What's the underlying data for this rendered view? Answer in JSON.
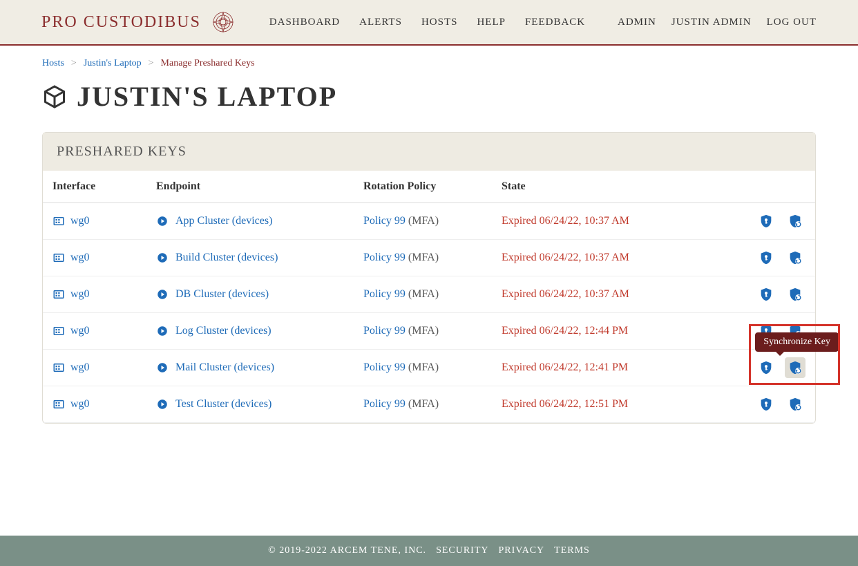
{
  "brand": "PRO CUSTODIBUS",
  "nav": {
    "dashboard": "DASHBOARD",
    "alerts": "ALERTS",
    "hosts": "HOSTS",
    "help": "HELP",
    "feedback": "FEEDBACK"
  },
  "user_nav": {
    "admin": "ADMIN",
    "user": "JUSTIN ADMIN",
    "logout": "LOG OUT"
  },
  "breadcrumb": {
    "hosts": "Hosts",
    "laptop": "Justin's Laptop",
    "current": "Manage Preshared Keys"
  },
  "page_title": "JUSTIN'S LAPTOP",
  "panel_title": "PRESHARED KEYS",
  "columns": {
    "interface": "Interface",
    "endpoint": "Endpoint",
    "policy": "Rotation Policy",
    "state": "State"
  },
  "tooltip": "Synchronize Key",
  "rows": [
    {
      "if": "wg0",
      "endpoint": "App Cluster (devices)",
      "policy": "Policy 99",
      "policy_suffix": "(MFA)",
      "state": "Expired 06/24/22, 10:37 AM"
    },
    {
      "if": "wg0",
      "endpoint": "Build Cluster (devices)",
      "policy": "Policy 99",
      "policy_suffix": "(MFA)",
      "state": "Expired 06/24/22, 10:37 AM"
    },
    {
      "if": "wg0",
      "endpoint": "DB Cluster (devices)",
      "policy": "Policy 99",
      "policy_suffix": "(MFA)",
      "state": "Expired 06/24/22, 10:37 AM"
    },
    {
      "if": "wg0",
      "endpoint": "Log Cluster (devices)",
      "policy": "Policy 99",
      "policy_suffix": "(MFA)",
      "state": "Expired 06/24/22, 12:44 PM"
    },
    {
      "if": "wg0",
      "endpoint": "Mail Cluster (devices)",
      "policy": "Policy 99",
      "policy_suffix": "(MFA)",
      "state": "Expired 06/24/22, 12:41 PM"
    },
    {
      "if": "wg0",
      "endpoint": "Test Cluster (devices)",
      "policy": "Policy 99",
      "policy_suffix": "(MFA)",
      "state": "Expired 06/24/22, 12:51 PM"
    }
  ],
  "footer": {
    "copyright": "© 2019-2022 ARCEM TENE, INC.",
    "security": "SECURITY",
    "privacy": "PRIVACY",
    "terms": "TERMS"
  }
}
